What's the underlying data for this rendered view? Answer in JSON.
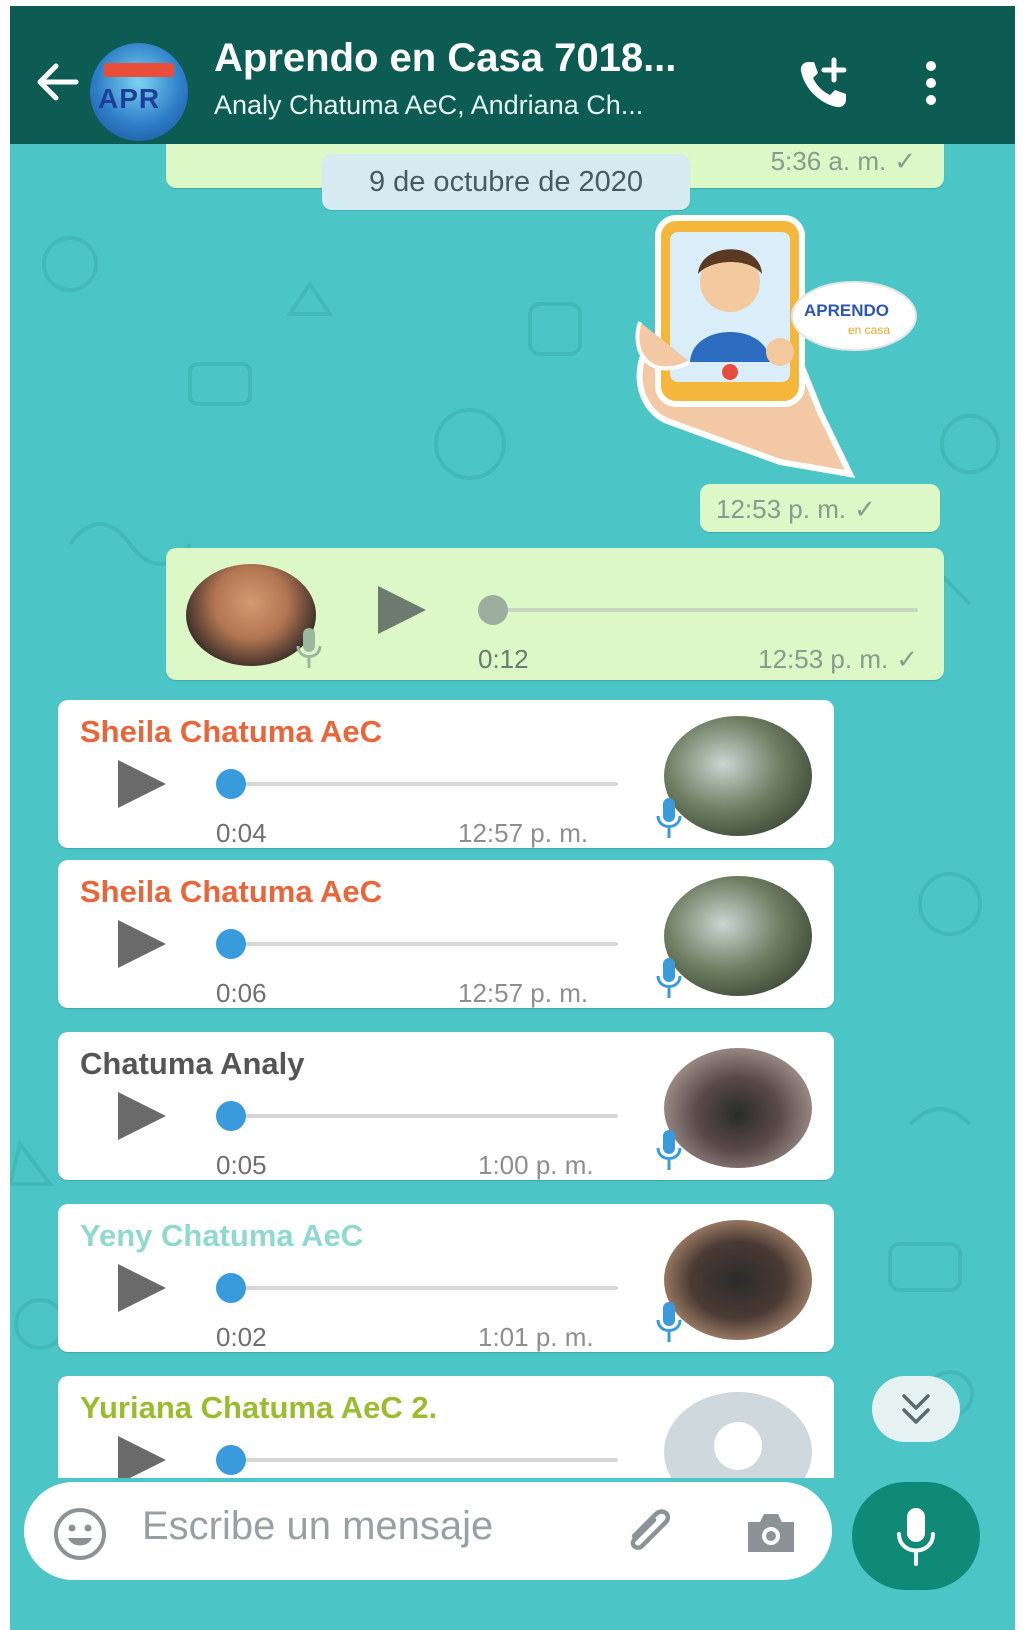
{
  "header": {
    "title": "Aprendo en Casa 7018...",
    "subtitle": "Analy Chatuma AeC, Andriana Ch...",
    "avatar_text": "APR"
  },
  "chat": {
    "top_partial_time": "5:36 a. m.",
    "date_separator": "9 de octubre de 2020",
    "sticker": {
      "badge_text": "APRENDO",
      "badge_sub": "en casa",
      "time": "12:53 p. m."
    },
    "own_voice": {
      "duration": "0:12",
      "time": "12:53 p. m."
    },
    "messages": [
      {
        "sender": "Sheila Chatuma AeC",
        "sender_color": "#e8663a",
        "duration": "0:04",
        "time": "12:57 p. m."
      },
      {
        "sender": "Sheila Chatuma AeC",
        "sender_color": "#e8663a",
        "duration": "0:06",
        "time": "12:57 p. m."
      },
      {
        "sender": "Chatuma Analy",
        "sender_color": "#555555",
        "duration": "0:05",
        "time": "1:00 p. m."
      },
      {
        "sender": "Yeny Chatuma AeC",
        "sender_color": "#8fd9cf",
        "duration": "0:02",
        "time": "1:01 p. m."
      },
      {
        "sender": "Yuriana Chatuma AeC 2.",
        "sender_color": "#9bbc2e",
        "duration": "",
        "time": ""
      }
    ]
  },
  "input": {
    "placeholder": "Escribe un mensaje"
  },
  "colors": {
    "header": "#0c5c53",
    "wallpaper": "#4cc5c6",
    "outgoing": "#dcf8c6",
    "mic_fab": "#0e8a76",
    "progress": "#3a9bdc"
  }
}
